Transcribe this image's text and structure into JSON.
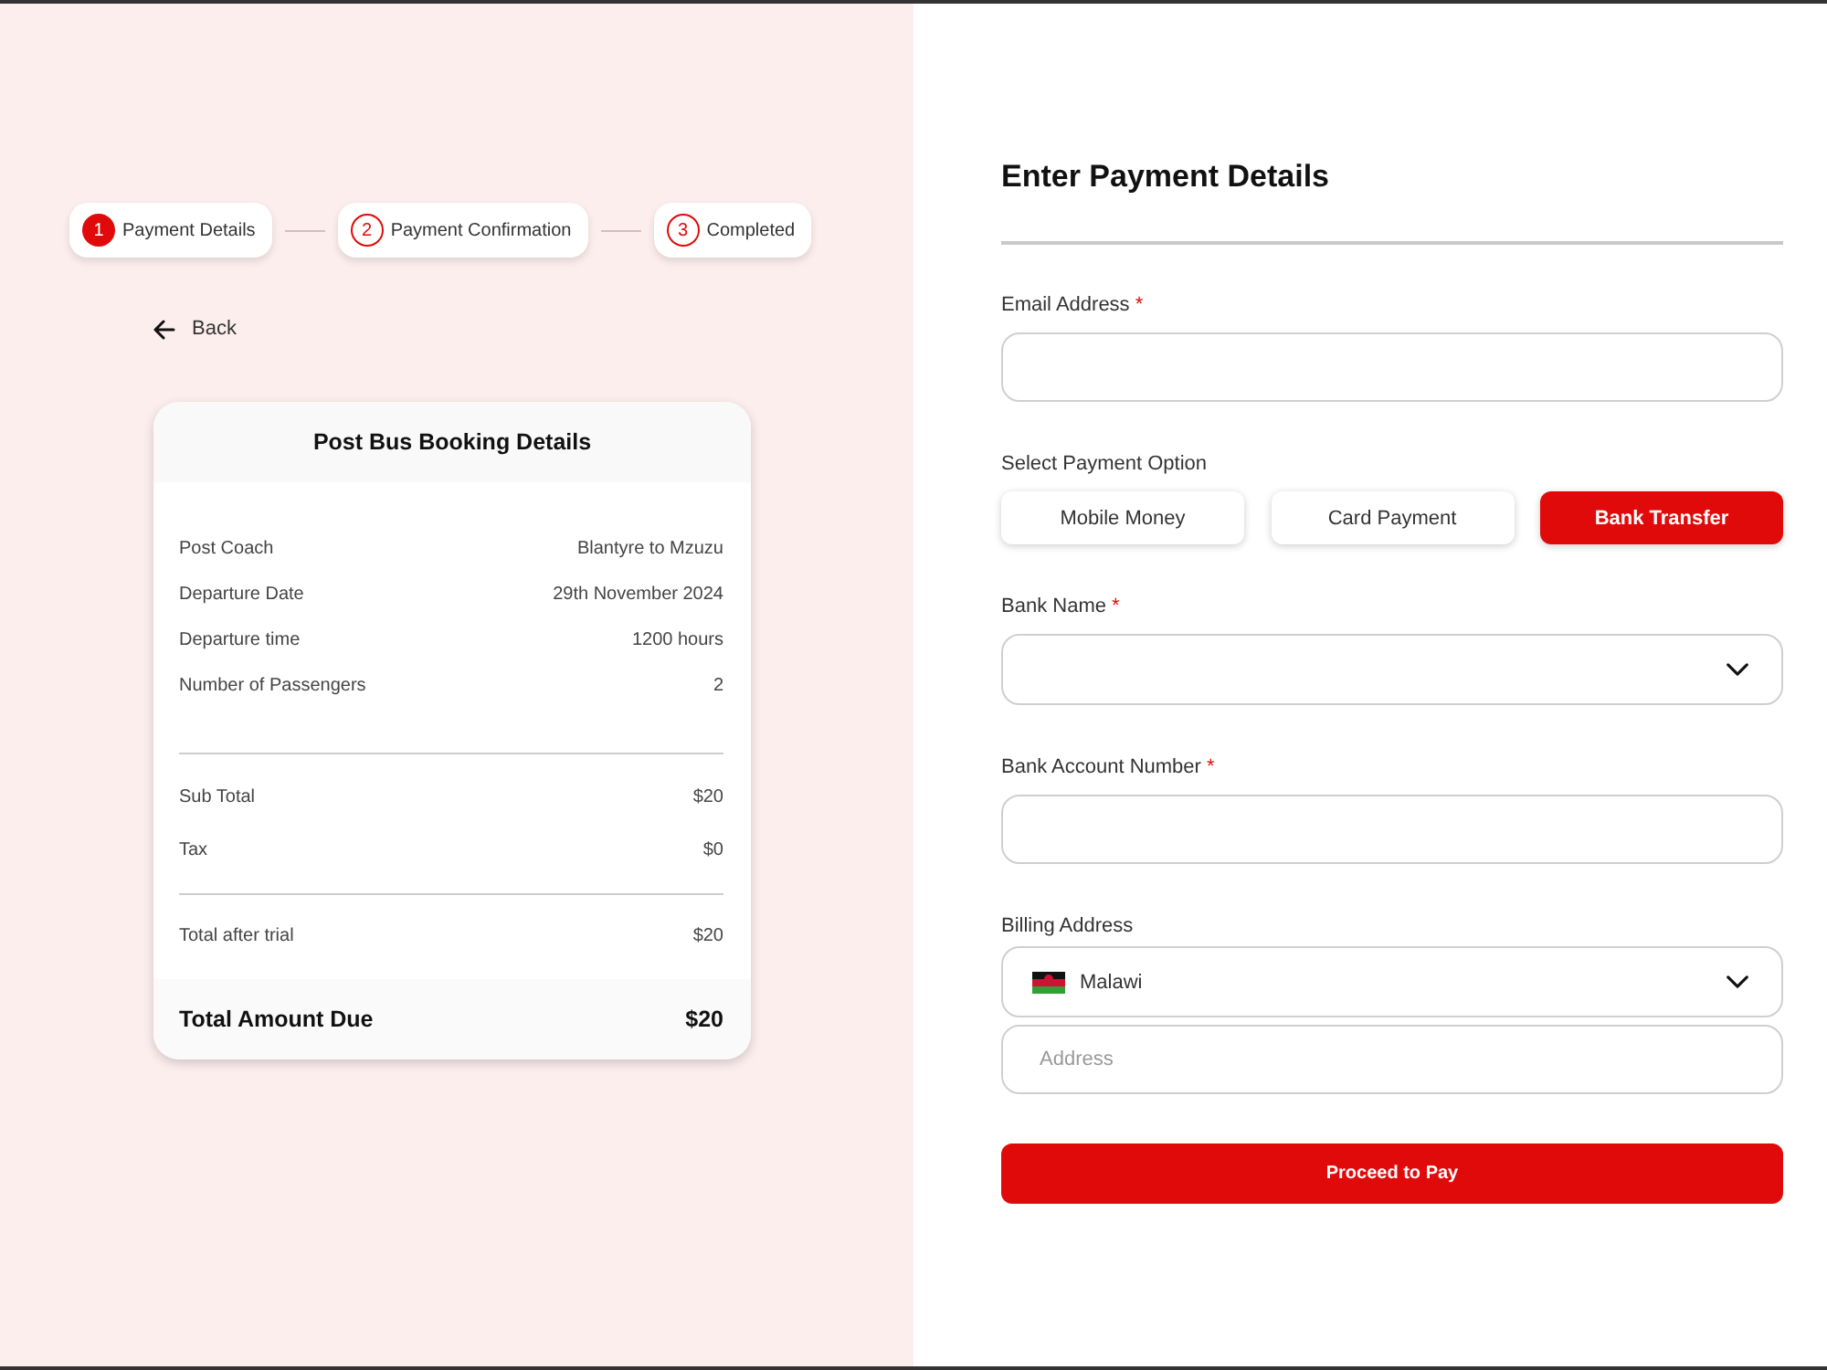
{
  "stepper": {
    "steps": [
      {
        "number": "1",
        "label": "Payment Details",
        "selected": true
      },
      {
        "number": "2",
        "label": "Payment Confirmation",
        "selected": false
      },
      {
        "number": "3",
        "label": "Completed",
        "selected": false
      }
    ]
  },
  "back_link": {
    "label": "Back"
  },
  "booking_card": {
    "title": "Post Bus Booking Details",
    "details": [
      {
        "label": "Post Coach",
        "value": "Blantyre to Mzuzu"
      },
      {
        "label": "Departure Date",
        "value": "29th November 2024"
      },
      {
        "label": "Departure time",
        "value": "1200 hours"
      },
      {
        "label": "Number of Passengers",
        "value": "2"
      }
    ],
    "charges": [
      {
        "label": "Sub Total",
        "value": "$20"
      },
      {
        "label": "Tax",
        "value": "$0"
      }
    ],
    "total_after_trial": {
      "label": "Total after trial",
      "value": "$20"
    },
    "total_due": {
      "label": "Total Amount Due",
      "value": "$20"
    }
  },
  "payment_form": {
    "title": "Enter Payment Details",
    "fields": [
      {
        "kind": "input",
        "label": "Email Address",
        "required_mark": "*"
      },
      {
        "kind": "options",
        "label": "Select Payment Option",
        "options": [
          {
            "label": "Mobile Money",
            "selected": false
          },
          {
            "label": "Card Payment",
            "selected": false
          },
          {
            "label": "Bank Transfer",
            "selected": true
          }
        ]
      },
      {
        "kind": "select",
        "label": "Bank Name",
        "required_mark": "*"
      },
      {
        "kind": "input",
        "label": "Bank Account Number",
        "required_mark": "*"
      },
      {
        "kind": "address",
        "label": "Billing Address",
        "country": "Malawi",
        "address_placeholder": "Address"
      }
    ],
    "submit_button": "Proceed to Pay"
  }
}
